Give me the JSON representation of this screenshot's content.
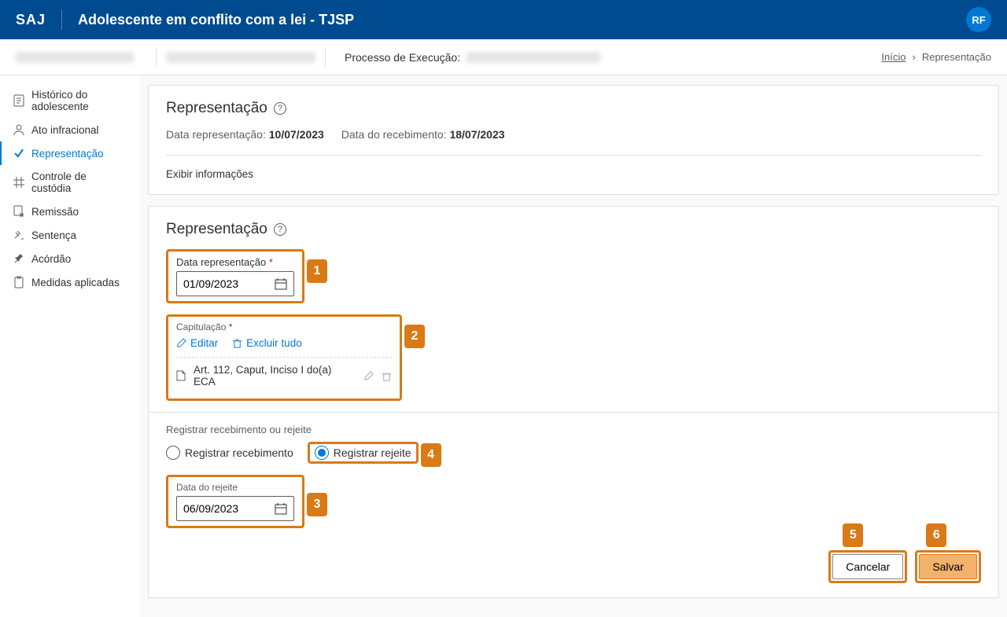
{
  "header": {
    "logo": "SAJ",
    "title": "Adolescente em conflito com a lei - TJSP",
    "user_initials": "RF"
  },
  "sub_header": {
    "process_label": "Processo de Execução:"
  },
  "breadcrumb": {
    "home": "Início",
    "current": "Representação"
  },
  "sidebar": {
    "items": [
      {
        "label": "Histórico do adolescente"
      },
      {
        "label": "Ato infracional"
      },
      {
        "label": "Representação"
      },
      {
        "label": "Controle de custódia"
      },
      {
        "label": "Remissão"
      },
      {
        "label": "Sentença"
      },
      {
        "label": "Acórdão"
      },
      {
        "label": "Medidas aplicadas"
      }
    ]
  },
  "summary": {
    "title": "Representação",
    "date_label": "Data representação:",
    "date_value": "10/07/2023",
    "receipt_label": "Data do recebimento:",
    "receipt_value": "18/07/2023",
    "show_info": "Exibir informações"
  },
  "form": {
    "title": "Representação",
    "date_label": "Data representação",
    "date_value": "01/09/2023",
    "capitulation_label": "Capitulação",
    "edit_label": "Editar",
    "delete_all_label": "Excluir tudo",
    "article": "Art. 112, Caput, Inciso I do(a) ECA",
    "register_label": "Registrar recebimento ou rejeite",
    "opt_receipt": "Registrar recebimento",
    "opt_reject": "Registrar rejeite",
    "reject_date_label": "Data do rejeite",
    "reject_date_value": "06/09/2023",
    "cancel": "Cancelar",
    "save": "Salvar"
  },
  "annotations": {
    "n1": "1",
    "n2": "2",
    "n3": "3",
    "n4": "4",
    "n5": "5",
    "n6": "6"
  }
}
